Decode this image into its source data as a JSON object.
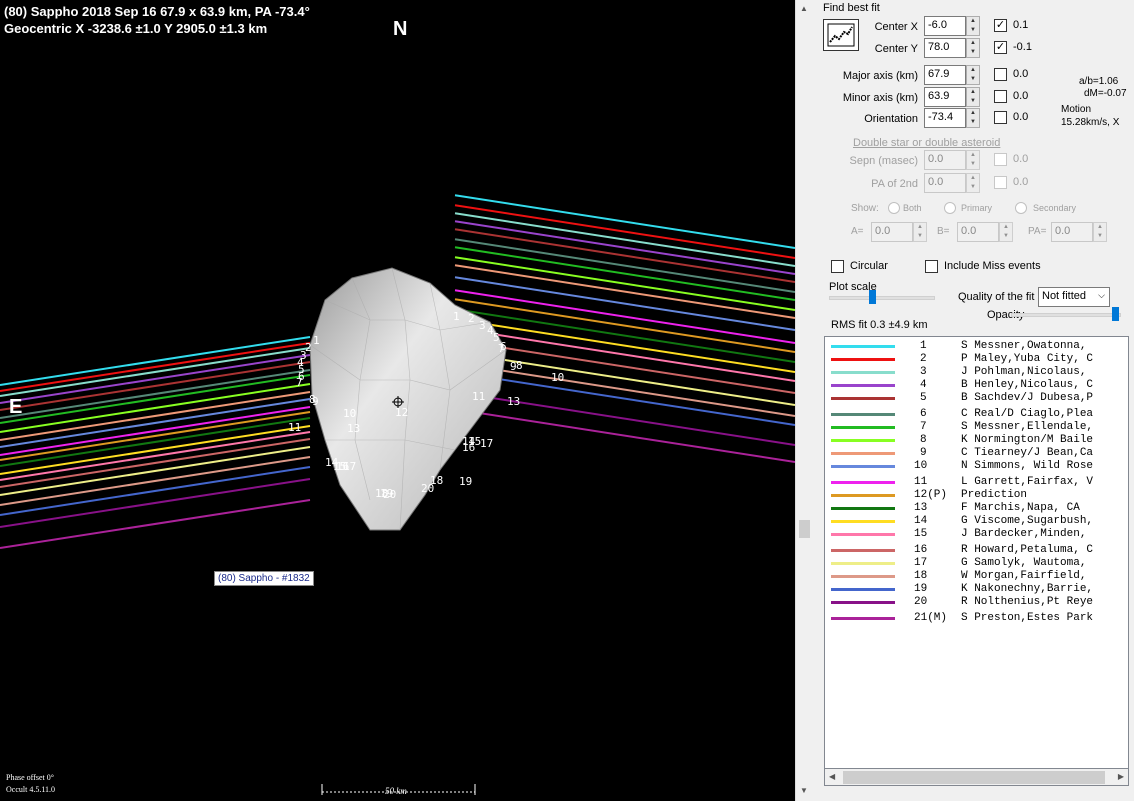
{
  "plot": {
    "header_line1": "(80) Sappho  2018 Sep 16  67.9 x 63.9 km, PA -73.4°",
    "header_line2": "Geocentric  X  -3238.6 ±1.0  Y 2905.0 ±1.3 km",
    "north_label": "N",
    "east_label": "E",
    "asteroid_label": "(80) Sappho - #1832",
    "phase_offset": "Phase offset 0°",
    "version": "Occult 4.5.11.0",
    "scale_label": "50 km",
    "chord_numbers_left": [
      "1",
      "2",
      "3",
      "4",
      "5",
      "6",
      "7",
      "8",
      "9",
      "10",
      "11",
      "12",
      "13",
      "14",
      "15",
      "16",
      "17",
      "18",
      "19",
      "20"
    ],
    "chord_numbers_right": [
      "1",
      "2",
      "3",
      "4",
      "5",
      "6",
      "7",
      "8",
      "9",
      "10",
      "11",
      "12",
      "13",
      "14",
      "15",
      "16",
      "17",
      "18",
      "19",
      "20"
    ]
  },
  "panel": {
    "find_best_fit": "Find best fit",
    "center_x_label": "Center X",
    "center_x_value": "-6.0",
    "center_x_step": "0.1",
    "center_y_label": "Center Y",
    "center_y_value": "78.0",
    "center_y_step": "-0.1",
    "major_label": "Major axis (km)",
    "major_value": "67.9",
    "major_step": "0.0",
    "minor_label": "Minor axis (km)",
    "minor_value": "63.9",
    "minor_step": "0.0",
    "orient_label": "Orientation",
    "orient_value": "-73.4",
    "orient_step": "0.0",
    "ab_ratio": "a/b=1.06",
    "dm": "dM=-0.07",
    "motion_label": "Motion",
    "motion_value": "15.28km/s, X",
    "double_link": "Double star  or  double asteroid",
    "sepn_label": "Sepn (masec)",
    "sepn_value": "0.0",
    "sepn_step": "0.0",
    "pa2_label": "PA of 2nd",
    "pa2_value": "0.0",
    "pa2_step": "0.0",
    "show_label": "Show:",
    "show_both": "Both",
    "show_primary": "Primary",
    "show_secondary": "Secondary",
    "a_label": "A=",
    "a_value": "0.0",
    "b_label": "B=",
    "b_value": "0.0",
    "pa_label": "PA=",
    "pa_value": "0.0",
    "circular_label": "Circular",
    "include_miss_label": "Include Miss events",
    "plot_scale_label": "Plot scale",
    "quality_label": "Quality of the fit",
    "quality_value": "Not fitted",
    "opacity_label": "Opacity",
    "rms_label": "RMS fit 0.3 ±4.9 km"
  },
  "observers": [
    {
      "num": "1",
      "name": "S Messner,Owatonna,",
      "color": "#33ddee"
    },
    {
      "num": "2",
      "name": "P Maley,Yuba City, C",
      "color": "#ee1111"
    },
    {
      "num": "3",
      "name": "J Pohlman,Nicolaus,",
      "color": "#88ddcc"
    },
    {
      "num": "4",
      "name": "B Henley,Nicolaus, C",
      "color": "#9944cc"
    },
    {
      "num": "5",
      "name": "B Sachdev/J Dubesa,P",
      "color": "#aa3333"
    },
    {
      "num": "6",
      "name": "C Real/D Ciaglo,Plea",
      "color": "#558877"
    },
    {
      "num": "7",
      "name": "S Messner,Ellendale,",
      "color": "#22bb22"
    },
    {
      "num": "8",
      "name": "K Normington/M Baile",
      "color": "#88ff22"
    },
    {
      "num": "9",
      "name": "C Tiearney/J Bean,Ca",
      "color": "#ee9977"
    },
    {
      "num": "10",
      "name": "N Simmons, Wild Rose",
      "color": "#6688dd"
    },
    {
      "num": "11",
      "name": "L Garrett,Fairfax, V",
      "color": "#ee22ee"
    },
    {
      "num": "12(P)",
      "name": "Prediction",
      "color": "#dd9922"
    },
    {
      "num": "13",
      "name": "F Marchis,Napa, CA",
      "color": "#117711"
    },
    {
      "num": "14",
      "name": "G Viscome,Sugarbush,",
      "color": "#ffdd22"
    },
    {
      "num": "15",
      "name": "J Bardecker,Minden,",
      "color": "#ff77aa"
    },
    {
      "num": "16",
      "name": "R Howard,Petaluma, C",
      "color": "#cc6666"
    },
    {
      "num": "17",
      "name": "G Samolyk, Wautoma,",
      "color": "#eeee88"
    },
    {
      "num": "18",
      "name": "W Morgan,Fairfield,",
      "color": "#dd9988"
    },
    {
      "num": "19",
      "name": "K Nakonechny,Barrie,",
      "color": "#4466cc"
    },
    {
      "num": "20",
      "name": "R Nolthenius,Pt Reye",
      "color": "#881188"
    },
    {
      "num": "21(M)",
      "name": "S Preston,Estes Park",
      "color": "#aa2299"
    }
  ]
}
